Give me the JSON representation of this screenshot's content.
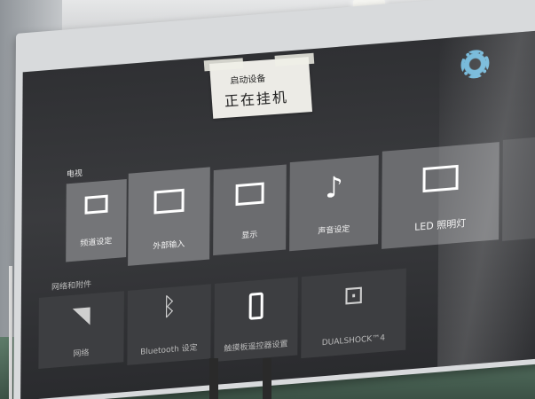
{
  "note": {
    "line1": "启动设备",
    "line2": "正在挂机"
  },
  "tv_section": {
    "label": "电视",
    "tiles": [
      {
        "label": "频道设定",
        "icon": "tv-antenna-icon"
      },
      {
        "label": "外部输入",
        "icon": "input-icon"
      },
      {
        "label": "显示",
        "icon": "display-icon"
      },
      {
        "label": "声音设定",
        "icon": "music-note-icon"
      },
      {
        "label": "LED 照明灯",
        "icon": "led-light-icon"
      }
    ]
  },
  "network_section": {
    "label": "网络和附件",
    "tiles": [
      {
        "label": "网络",
        "icon": "wifi-icon"
      },
      {
        "label": "Bluetooth 设定",
        "icon": "bluetooth-icon"
      },
      {
        "label": "触摸板遥控器设置",
        "icon": "remote-icon"
      },
      {
        "label": "DUALSHOCK™4",
        "icon": "gamepad-icon"
      }
    ]
  },
  "colors": {
    "accent": "#6fb6d8",
    "screen": "#2f3033",
    "tile": "#6b6c6f"
  }
}
